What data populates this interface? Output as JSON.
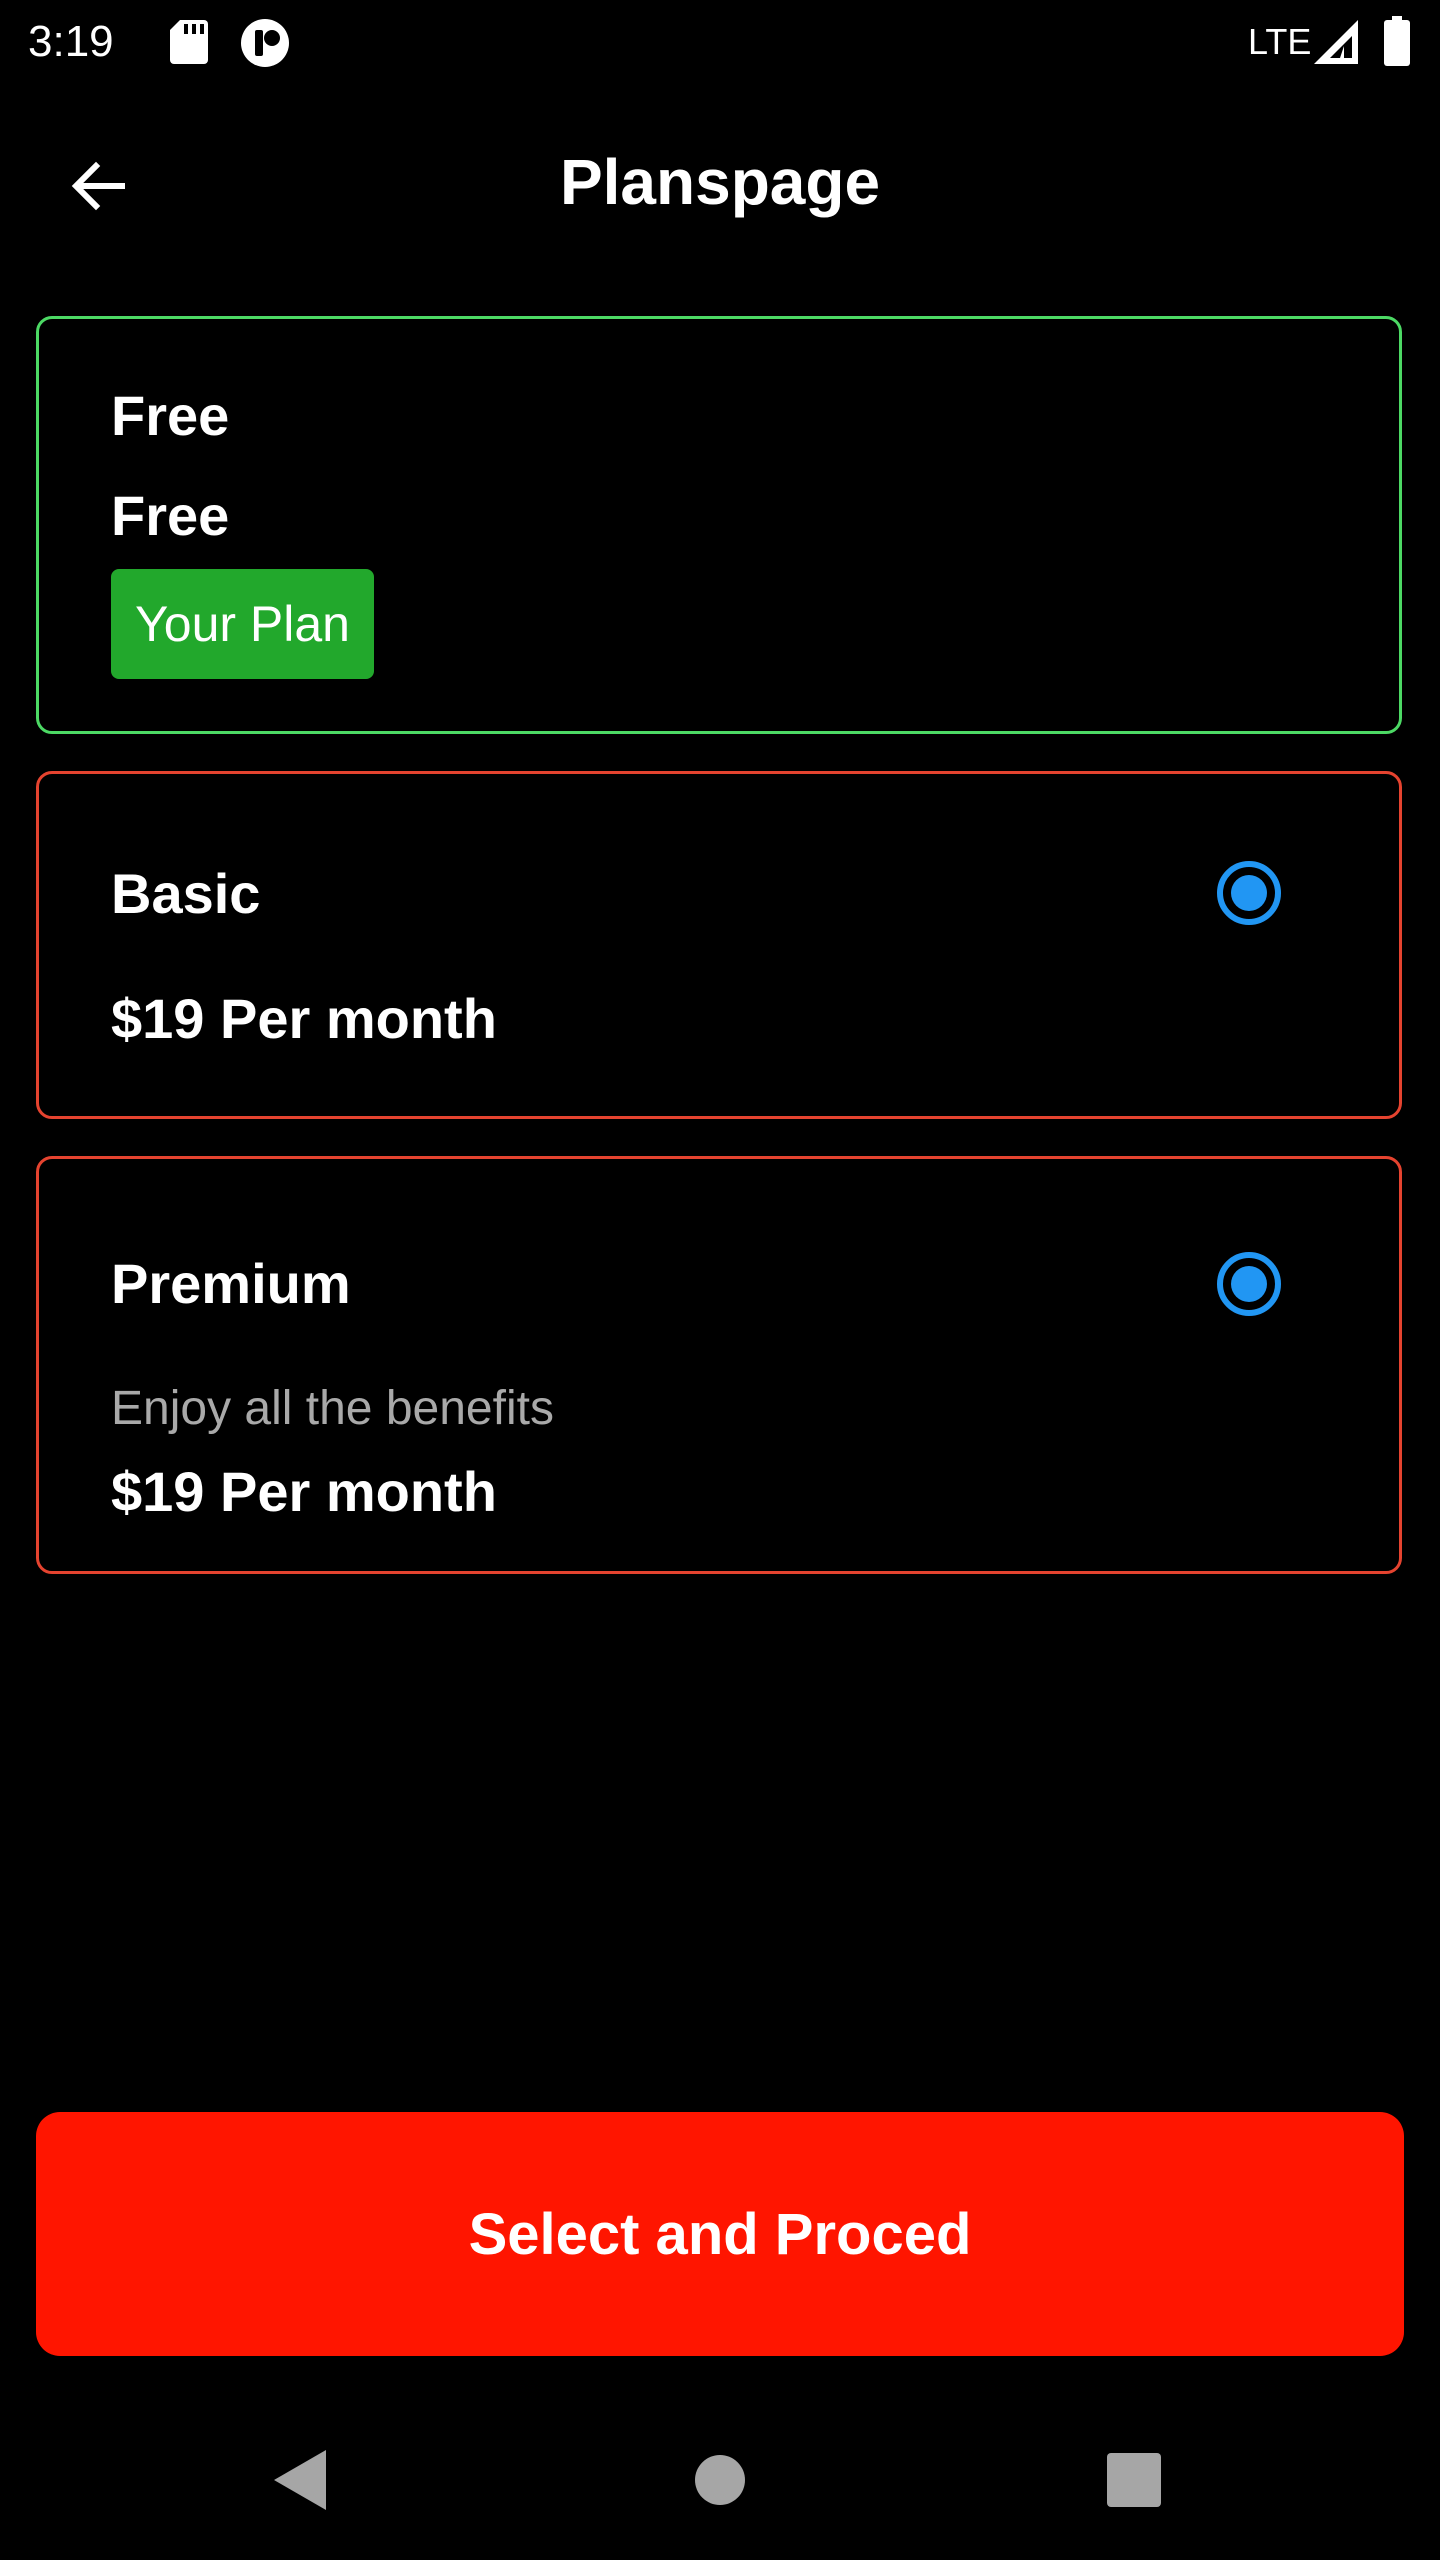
{
  "status_bar": {
    "time": "3:19",
    "network": "LTE",
    "icons": [
      "sd-card-icon",
      "app-notification-icon",
      "signal-icon",
      "battery-icon"
    ]
  },
  "app_bar": {
    "title": "Planspage",
    "back_icon": "back-arrow-icon"
  },
  "plans": {
    "free": {
      "name": "Free",
      "price": "Free",
      "badge": "Your Plan",
      "border_color": "#4CD964"
    },
    "basic": {
      "name": "Basic",
      "price": "$19 Per month",
      "selected": true,
      "border_color": "#E5432F"
    },
    "premium": {
      "name": "Premium",
      "description": "Enjoy all the benefits",
      "price": "$19 Per month",
      "selected": true,
      "border_color": "#E5432F"
    }
  },
  "proceed_button": {
    "label": "Select and Proced",
    "color": "#FF1500"
  },
  "nav_bar": {
    "icons": [
      "back-triangle-icon",
      "home-circle-icon",
      "recents-square-icon"
    ]
  },
  "colors": {
    "background": "#000000",
    "radio_accent": "#2196F3",
    "badge_green": "#22A82C"
  }
}
